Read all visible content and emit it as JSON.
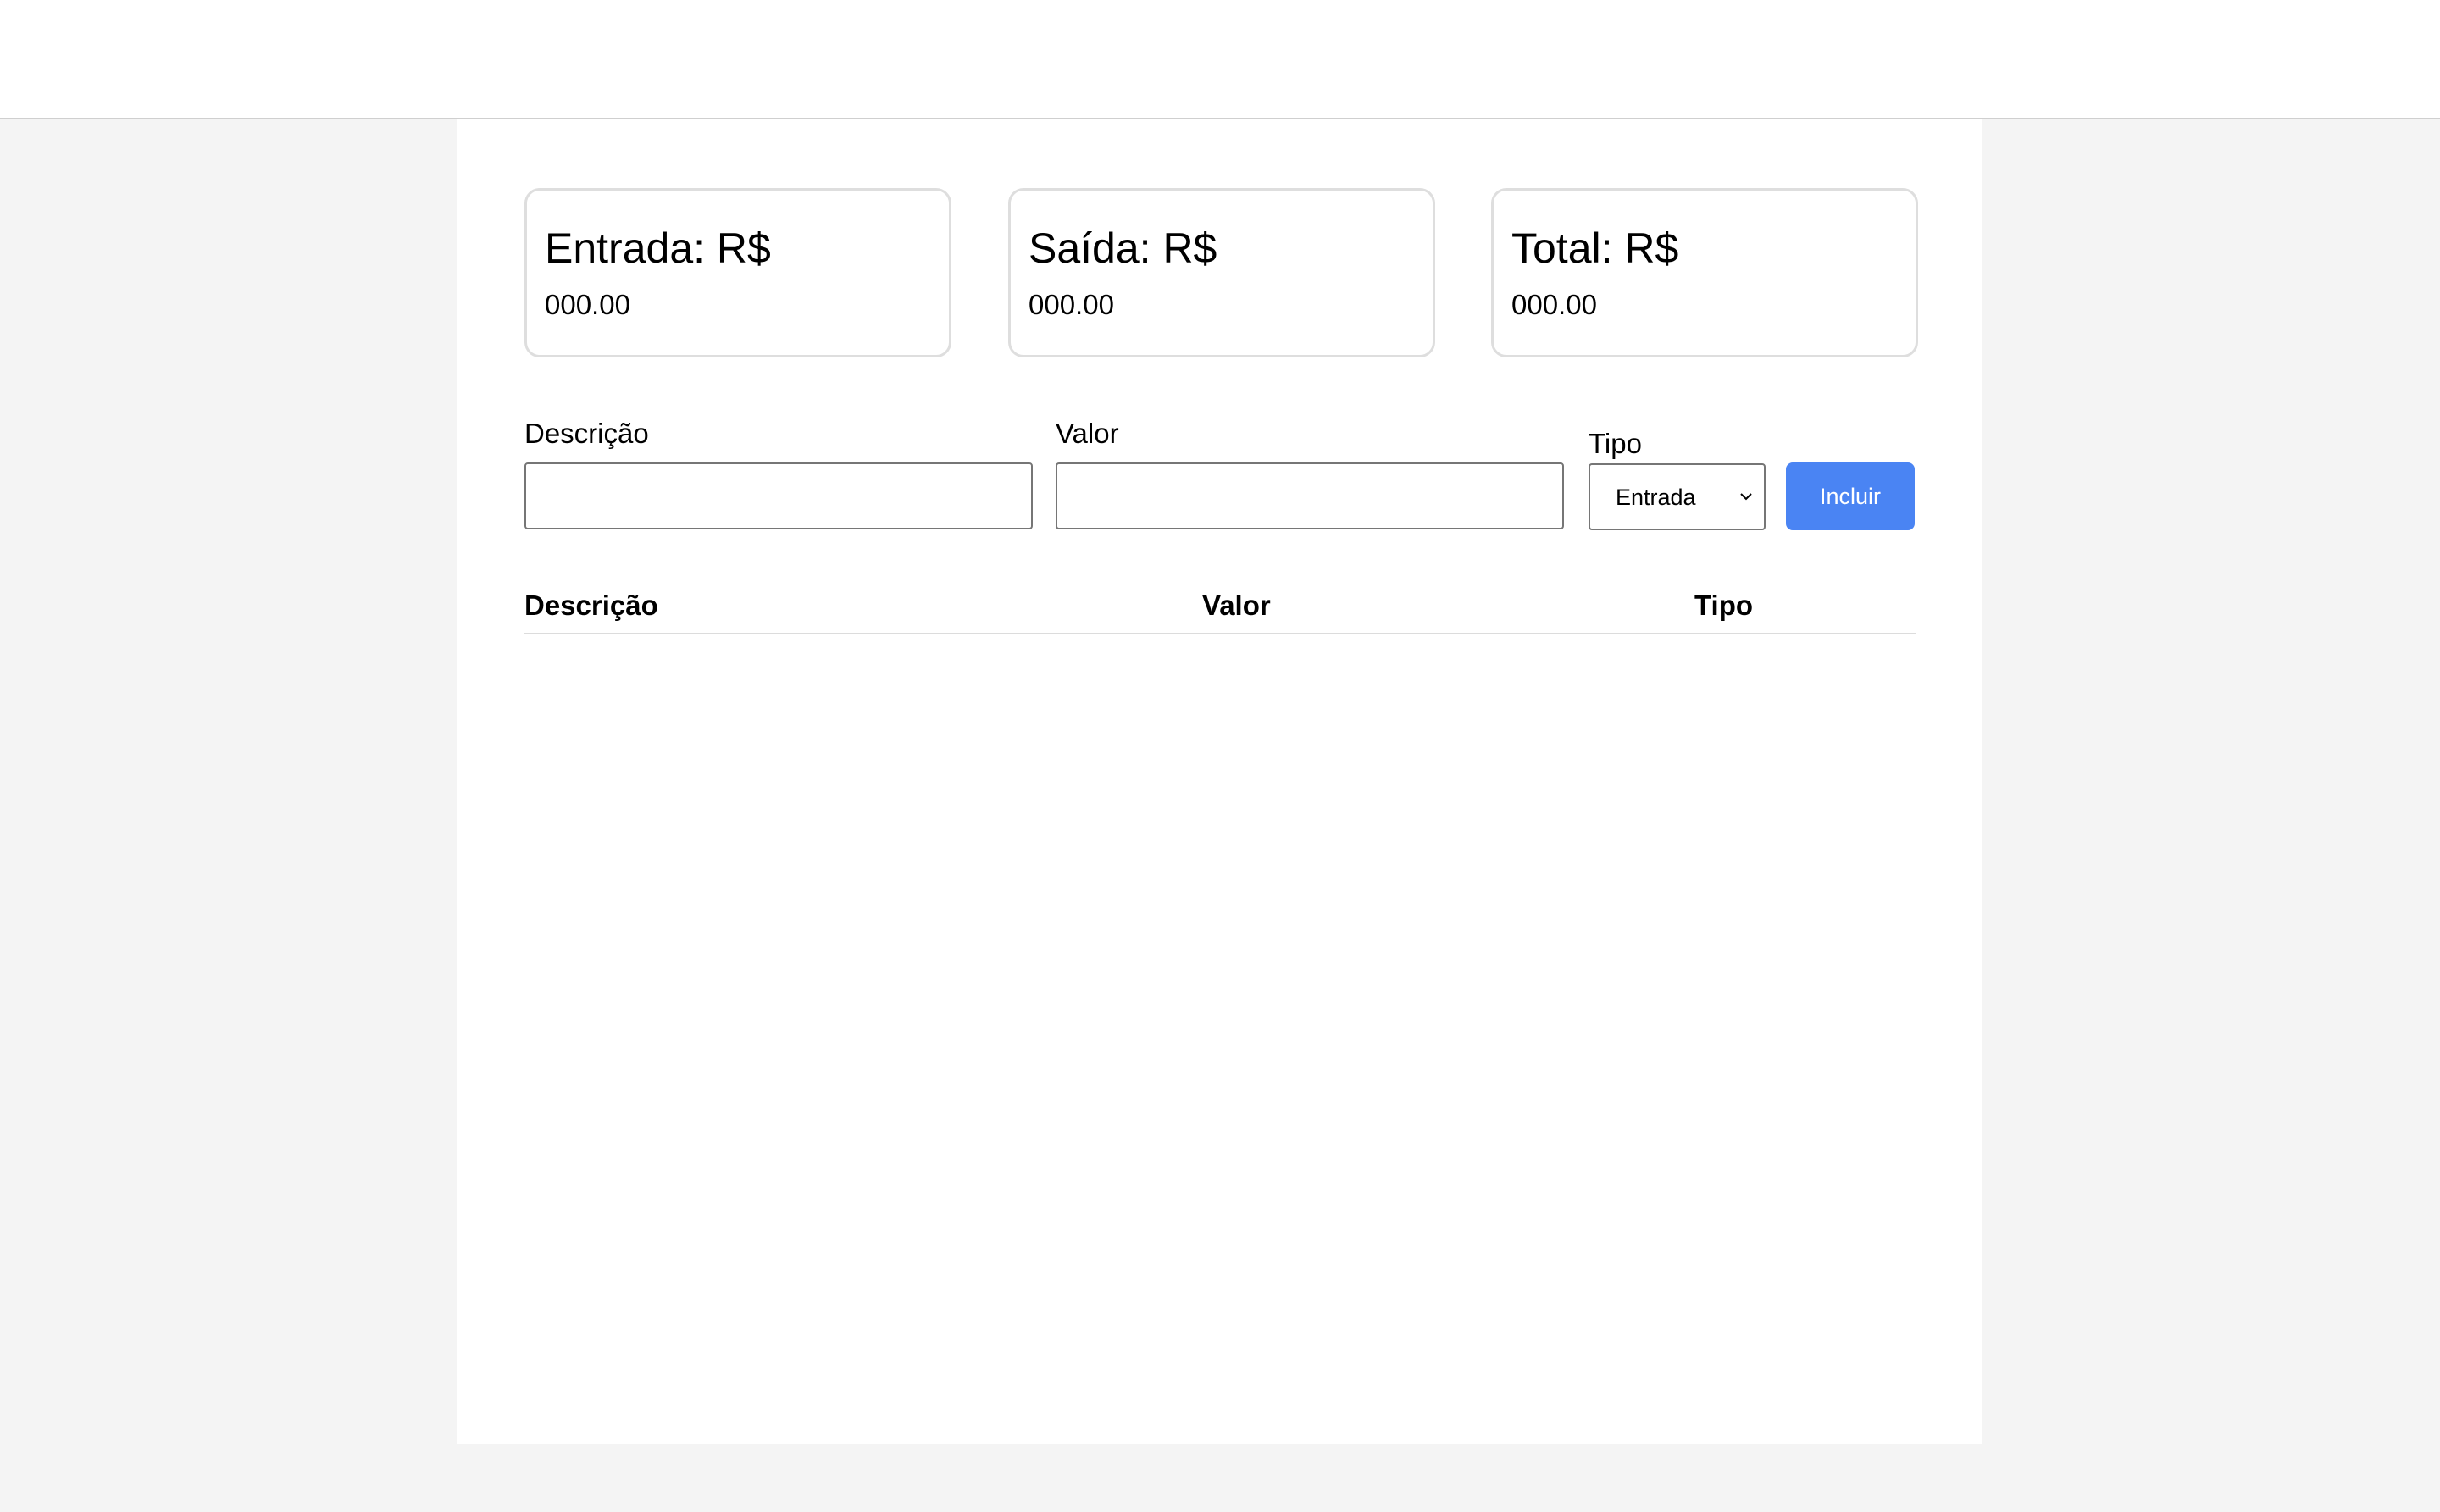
{
  "summary": {
    "entrada": {
      "label": "Entrada: R$",
      "value": "000.00"
    },
    "saida": {
      "label": "Saída: R$",
      "value": "000.00"
    },
    "total": {
      "label": "Total: R$",
      "value": "000.00"
    }
  },
  "form": {
    "descricao_label": "Descrição",
    "descricao_value": "",
    "valor_label": "Valor",
    "valor_value": "",
    "tipo_label": "Tipo",
    "tipo_selected": "Entrada",
    "submit_label": "Incluir"
  },
  "table": {
    "headers": [
      "Descrição",
      "Valor",
      "Tipo"
    ],
    "rows": []
  },
  "colors": {
    "accent": "#4a84f3",
    "page_background": "#f4f4f4",
    "card_border": "#dedede"
  },
  "icons": {
    "select_caret": "chevron-down-icon"
  }
}
